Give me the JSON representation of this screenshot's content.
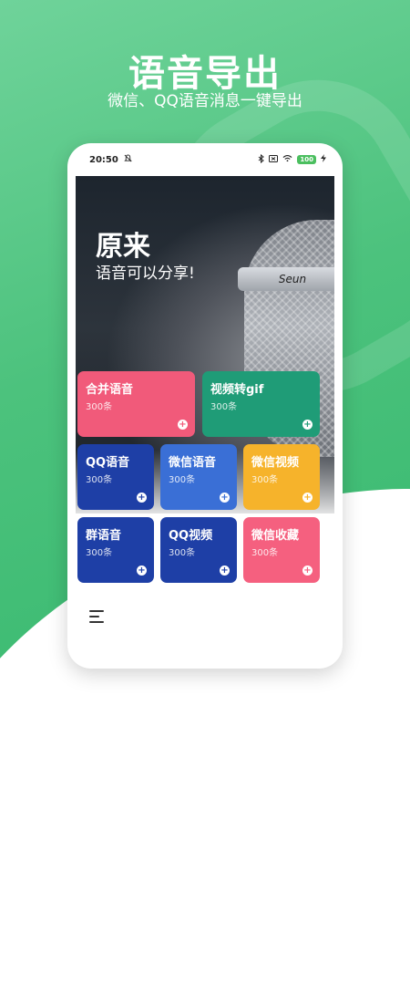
{
  "hero": {
    "title": "语音导出",
    "subtitle": "微信、QQ语音消息一键导出"
  },
  "status_bar": {
    "time": "20:50",
    "battery": "100"
  },
  "banner": {
    "title": "原来",
    "subtitle": "语音可以分享!",
    "mic_text": "Seun"
  },
  "tiles": [
    {
      "name": "合并语音",
      "count": "300条",
      "color": "#f15a7a"
    },
    {
      "name": "视频转gif",
      "count": "300条",
      "color": "#1f9c77"
    },
    {
      "name": "QQ语音",
      "count": "300条",
      "color": "#1e3fa6"
    },
    {
      "name": "微信语音",
      "count": "300条",
      "color": "#3a6fd6"
    },
    {
      "name": "微信视频",
      "count": "300条",
      "color": "#f6b32b"
    },
    {
      "name": "群语音",
      "count": "300条",
      "color": "#1e3fa6"
    },
    {
      "name": "QQ视频",
      "count": "300条",
      "color": "#1e3fa6"
    },
    {
      "name": "微信收藏",
      "count": "300条",
      "color": "#f5607f"
    }
  ],
  "icons": {
    "plus": "+",
    "menu": "menu-icon"
  }
}
